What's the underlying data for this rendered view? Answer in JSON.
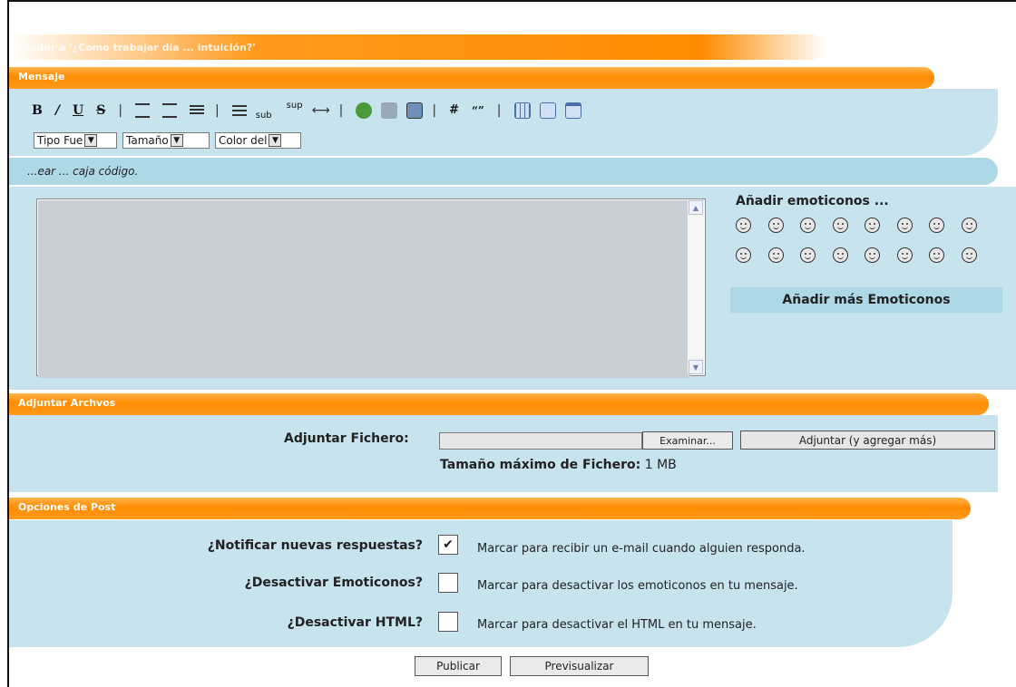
{
  "header": {
    "title": "...der a '¿Como trabajar día ... intuición?'"
  },
  "sections": {
    "message_label": "Mensaje",
    "attach_label": "Adjuntar Archvos",
    "options_label": "Opciones de Post"
  },
  "toolbar": {
    "bold": "B",
    "italic": "/",
    "underline": "U",
    "strike": "S",
    "sep": "|",
    "sub": "sub",
    "sup": "sup",
    "hr": "⟷",
    "hash": "#",
    "quote": "“”"
  },
  "selects": {
    "font": "Tipo Fue",
    "size": "Tamaño",
    "color": "Color del"
  },
  "code_hint": "...ear ... caja código.",
  "emoticons": {
    "title": "Añadir emoticonos ...",
    "more": "Añadir más Emoticonos"
  },
  "attach": {
    "label": "Adjuntar Fichero:",
    "browse": "Examinar...",
    "attach_button": "Adjuntar (y agregar más)",
    "max_label": "Tamaño máximo de Fichero:",
    "max_value": "1 MB"
  },
  "options": [
    {
      "label": "¿Notificar nuevas respuestas?",
      "desc": "Marcar para recibir un e-mail cuando alguien responda.",
      "checked": true
    },
    {
      "label": "¿Desactivar Emoticonos?",
      "desc": "Marcar para desactivar los emoticonos en tu mensaje.",
      "checked": false
    },
    {
      "label": "¿Desactivar HTML?",
      "desc": "Marcar para desactivar el HTML en tu mensaje.",
      "checked": false
    }
  ],
  "buttons": {
    "publish": "Publicar",
    "preview": "Previsualizar"
  },
  "colors": {
    "orange": "#ff8c00",
    "light_blue": "#c6e3ee",
    "mid_blue": "#add8e6"
  }
}
